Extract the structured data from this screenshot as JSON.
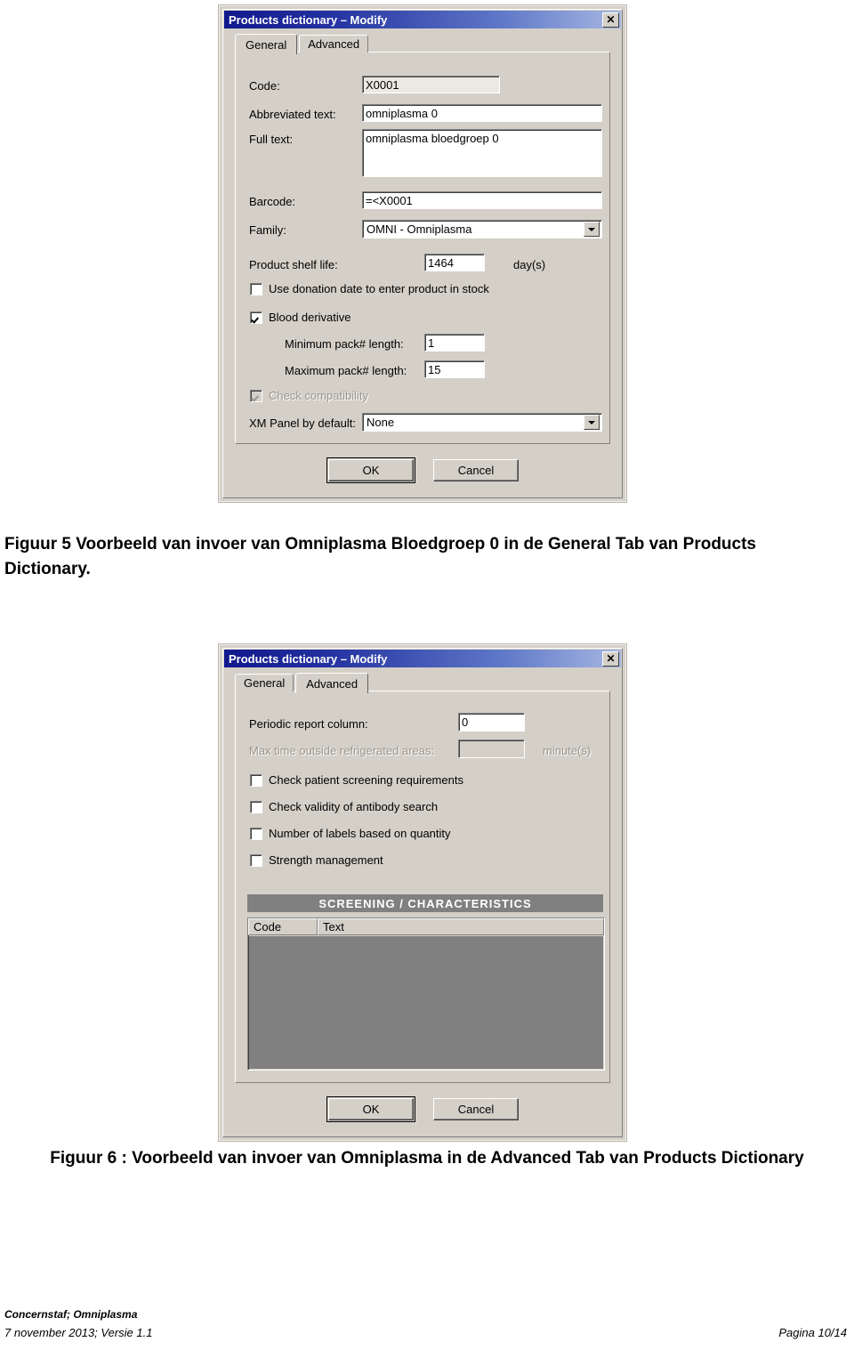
{
  "figure5": {
    "dialog": {
      "title": "Products dictionary – Modify",
      "close_icon": "close-icon",
      "tabs": [
        {
          "label": "General",
          "active": true
        },
        {
          "label": "Advanced",
          "active": false
        }
      ],
      "fields": {
        "code_label": "Code:",
        "code_value": "X0001",
        "abbrev_label": "Abbreviated text:",
        "abbrev_value": "omniplasma 0",
        "fulltext_label": "Full text:",
        "fulltext_value": "omniplasma bloedgroep 0",
        "barcode_label": "Barcode:",
        "barcode_value": "=<X0001",
        "family_label": "Family:",
        "family_value": "OMNI - Omniplasma",
        "shelf_label": "Product shelf life:",
        "shelf_value": "1464",
        "shelf_unit": "day(s)",
        "donation_cb_label": "Use donation date to enter product in stock",
        "donation_cb_checked": false,
        "blood_cb_label": "Blood derivative",
        "blood_cb_checked": true,
        "minpack_label": "Minimum pack# length:",
        "minpack_value": "1",
        "maxpack_label": "Maximum pack# length:",
        "maxpack_value": "15",
        "compat_cb_label": "Check compatibility",
        "compat_cb_checked": true,
        "xm_label": "XM Panel by default:",
        "xm_value": "None"
      },
      "buttons": {
        "ok": "OK",
        "cancel": "Cancel"
      }
    },
    "caption": "Figuur 5  Voorbeeld van invoer van Omniplasma Bloedgroep 0  in de General Tab van Products Dictionary."
  },
  "figure6": {
    "dialog": {
      "title": "Products dictionary – Modify",
      "close_icon": "close-icon",
      "tabs": [
        {
          "label": "General",
          "active": false
        },
        {
          "label": "Advanced",
          "active": true
        }
      ],
      "fields": {
        "periodic_label": "Periodic report column:",
        "periodic_value": "0",
        "maxtime_label": "Max time outside refrigerated areas:",
        "maxtime_value": "",
        "maxtime_unit": "minute(s)",
        "cb1_label": "Check patient screening requirements",
        "cb1_checked": false,
        "cb2_label": "Check validity of antibody search",
        "cb2_checked": false,
        "cb3_label": "Number of labels based on quantity",
        "cb3_checked": false,
        "cb4_label": "Strength management",
        "cb4_checked": false
      },
      "screening": {
        "header": "SCREENING / CHARACTERISTICS",
        "columns": [
          "Code",
          "Text"
        ],
        "rows": []
      },
      "buttons": {
        "ok": "OK",
        "cancel": "Cancel"
      }
    },
    "caption": "Figuur 6 : Voorbeeld van invoer van Omniplasma in de Advanced Tab van Products Dictionary"
  },
  "footer": {
    "org": "Concernstaf; Omniplasma",
    "date_version": "7 november 2013; Versie 1.1",
    "page": "Pagina 10/14"
  },
  "colors": {
    "title_bar_start": "#11198c",
    "title_bar_end": "#a7b7e2",
    "dialog_face": "#d4d0c8",
    "grid_empty": "#808080"
  }
}
